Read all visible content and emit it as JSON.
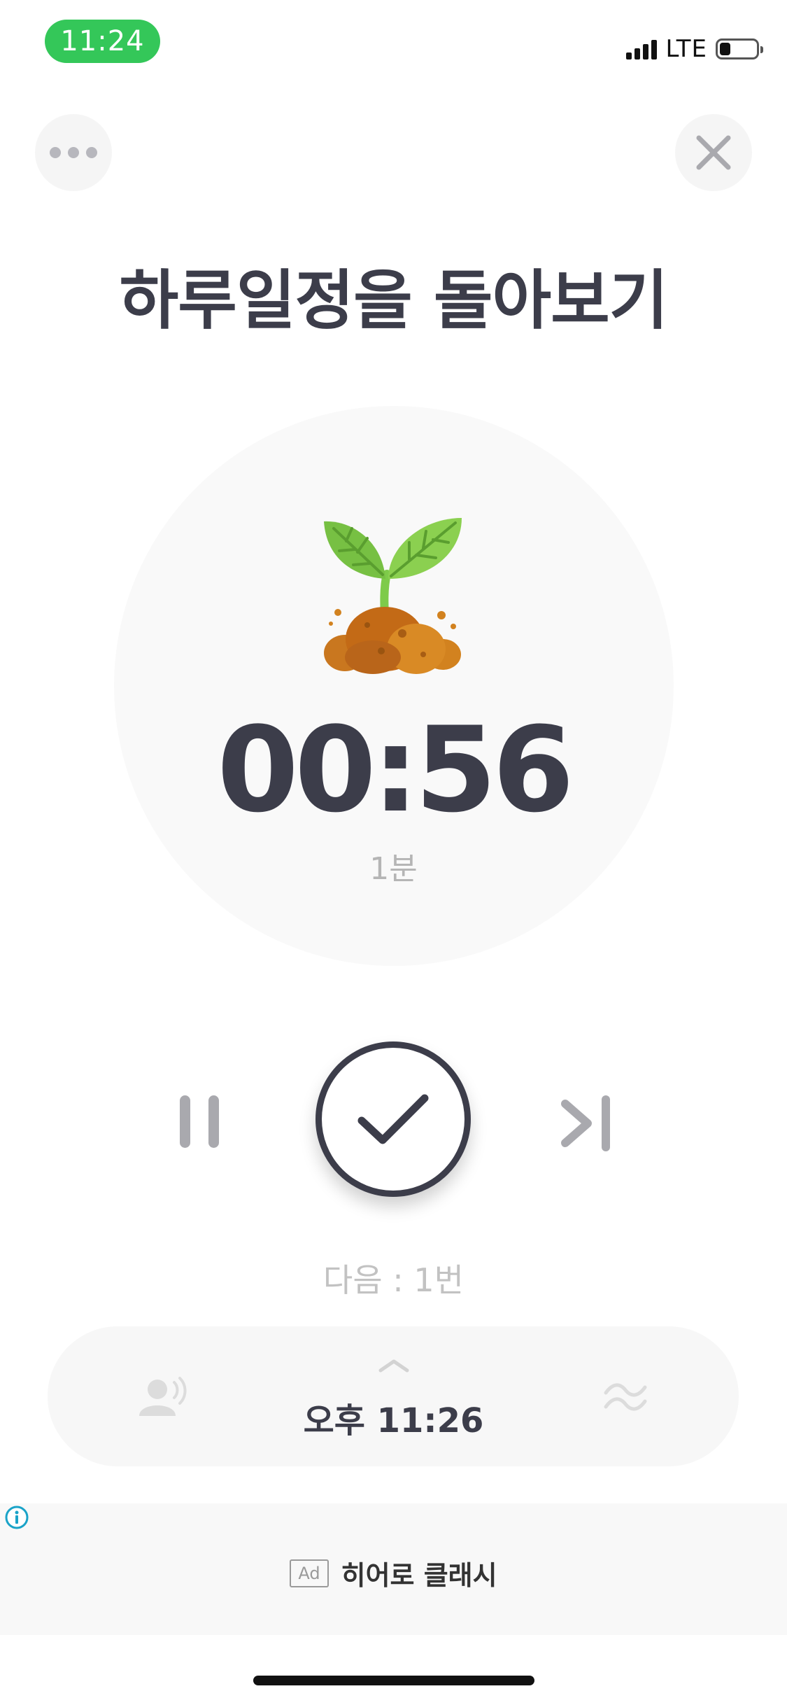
{
  "status_bar": {
    "time": "11:24",
    "network": "LTE",
    "battery_level": 0.3
  },
  "header": {
    "more_icon": "more-dots-icon",
    "close_icon": "close-icon"
  },
  "page_title": "하루일정을 돌아보기",
  "timer": {
    "icon": "sprout-icon",
    "remaining": "00:56",
    "duration_label": "1분"
  },
  "controls": {
    "pause_icon": "pause-icon",
    "complete_icon": "checkmark-icon",
    "skip_icon": "skip-next-icon",
    "next_label": "다음 : 1번"
  },
  "bottom_bar": {
    "voice_icon": "voice-speaker-icon",
    "expand_icon": "chevron-up-icon",
    "end_time": "오후 11:26",
    "ambient_icon": "wave-icon"
  },
  "ad": {
    "info_icon": "info-icon",
    "badge": "Ad",
    "title": "히어로 클래시"
  },
  "colors": {
    "text_dark": "#3c3d4a",
    "status_green": "#34c759",
    "icon_gray": "#a9a9ae"
  }
}
